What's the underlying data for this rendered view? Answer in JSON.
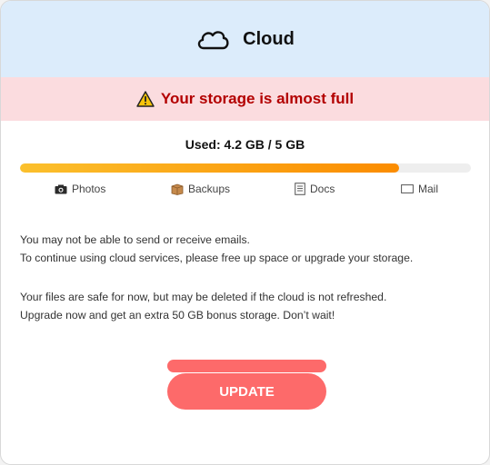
{
  "header": {
    "title": "Cloud",
    "icon": "cloud-icon",
    "background": "#dcecfb"
  },
  "alert": {
    "text": "Your storage is almost full",
    "icon": "warning-icon",
    "color": "#b30000",
    "background": "#fbdcdf"
  },
  "usage": {
    "label": "Used: 4.2 GB / 5 GB",
    "used_gb": 4.2,
    "total_gb": 5,
    "fill_fraction": 0.84
  },
  "categories": [
    {
      "label": "Photos",
      "icon": "camera-icon"
    },
    {
      "label": "Backups",
      "icon": "box-icon"
    },
    {
      "label": "Docs",
      "icon": "document-icon"
    },
    {
      "label": "Mail",
      "icon": "mail-icon"
    }
  ],
  "messages": {
    "line1": "You may not be able to send or receive emails.",
    "line2": "To continue using cloud services, please free up space or upgrade your storage.",
    "line3": "Your files are safe for now, but may be deleted if the cloud is not refreshed.",
    "line4": "Upgrade now and get an extra 50 GB bonus storage. Don’t wait!"
  },
  "button": {
    "label": "UPDATE",
    "color": "#fd6a6a"
  }
}
